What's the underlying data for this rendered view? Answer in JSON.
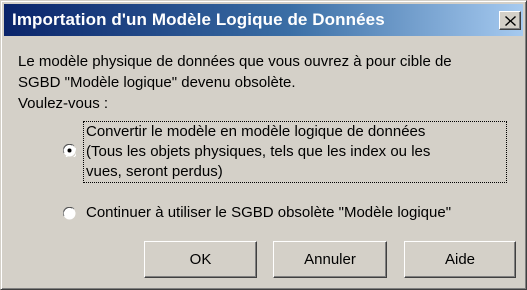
{
  "dialog": {
    "title": "Importation d'un Modèle Logique de Données",
    "message_line1": "Le modèle physique de données que vous ouvrez à pour cible de",
    "message_line2": "SGBD \"Modèle logique\" devenu obsolète.",
    "question": "Voulez-vous :"
  },
  "options": [
    {
      "line1": "Convertir le modèle en modèle logique de données",
      "line2": "(Tous les objets physiques, tels que les index ou les",
      "line3": "vues, seront perdus)",
      "selected": true
    },
    {
      "line1": "Continuer à utiliser le SGBD obsolète \"Modèle logique\"",
      "selected": false
    }
  ],
  "buttons": {
    "ok": "OK",
    "cancel": "Annuler",
    "help": "Aide"
  },
  "colors": {
    "face": "#d4d0c8",
    "title_start": "#0a246a",
    "title_end": "#a6caf0"
  }
}
